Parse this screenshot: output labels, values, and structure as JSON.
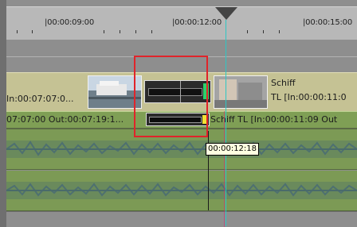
{
  "ruler": {
    "labels": [
      "|00:00:09:00",
      "|00:00:12:00",
      "|00:00:15:00"
    ]
  },
  "video_track": {
    "clip1_text": "In:00:07:07:0...",
    "clip2_title": "Schiff",
    "clip2_tl": "TL [In:00:00:11:0"
  },
  "audio_label_track": {
    "clip1_text": "07:07:00 Out:00:07:19:1...",
    "clip2_text": "Schiff  TL [In:00:00:11:09 Out"
  },
  "tooltip": {
    "time": "00:00:12:18"
  },
  "colors": {
    "video_track": "#c5c294",
    "audio_track": "#7c9a55",
    "playhead_line": "#2fc7c4",
    "selection": "#e0242a",
    "transition_green": "#2bd16a",
    "transition_yellow": "#f2e234"
  }
}
